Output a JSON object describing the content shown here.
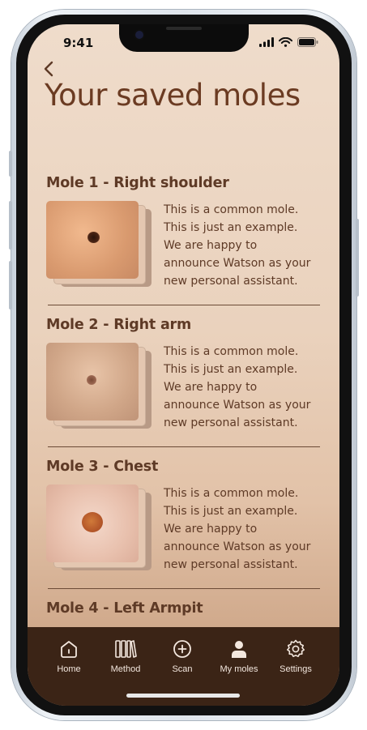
{
  "status_bar": {
    "time": "9:41"
  },
  "header": {
    "title": "Your saved moles"
  },
  "moles": [
    {
      "title": "Mole 1 - Right shoulder",
      "description": [
        "This is a common mole.",
        "This is just an example.",
        "We are happy to",
        "announce Watson as your",
        "new personal assistant."
      ]
    },
    {
      "title": "Mole 2 - Right arm",
      "description": [
        "This is a common mole.",
        "This is just an example.",
        "We are happy to",
        "announce Watson as your",
        "new personal assistant."
      ]
    },
    {
      "title": "Mole 3 - Chest",
      "description": [
        "This is a common mole.",
        "This is just an example.",
        "We are happy to",
        "announce Watson as your",
        "new personal assistant."
      ]
    },
    {
      "title": "Mole 4 - Left Armpit"
    }
  ],
  "tabbar": {
    "items": [
      {
        "label": "Home",
        "icon": "home-icon"
      },
      {
        "label": "Method",
        "icon": "books-icon"
      },
      {
        "label": "Scan",
        "icon": "plus-circle-icon"
      },
      {
        "label": "My moles",
        "icon": "person-icon"
      },
      {
        "label": "Settings",
        "icon": "gear-icon"
      }
    ]
  },
  "colors": {
    "title": "#6b3b22",
    "text": "#5e3a26",
    "tabbar": "#3b2416"
  }
}
